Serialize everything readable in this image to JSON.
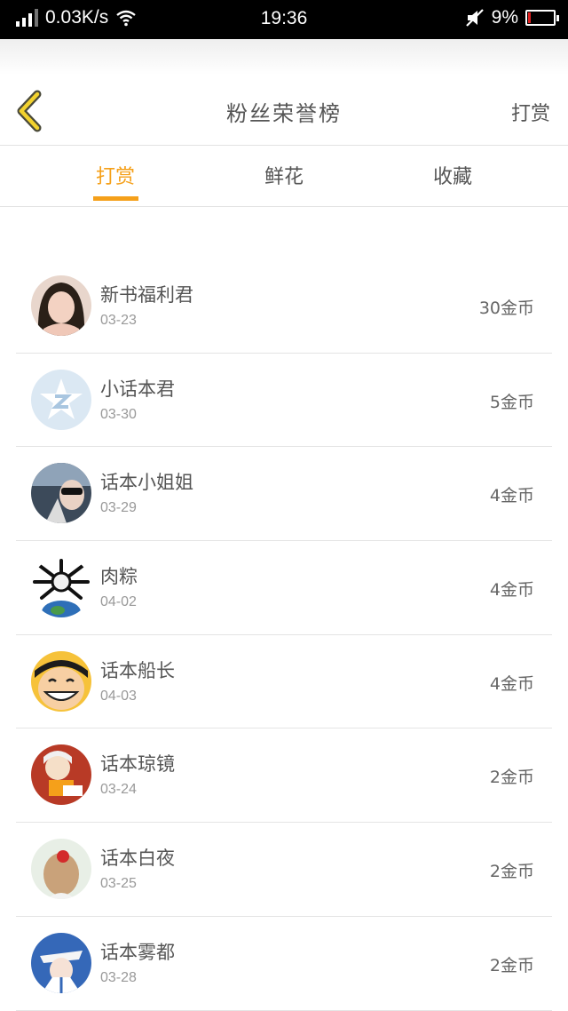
{
  "status": {
    "speed": "0.03K/s",
    "time": "19:36",
    "battery": "9%",
    "battery_level": 0.09
  },
  "nav": {
    "title": "粉丝荣誉榜",
    "right_label": "打赏"
  },
  "tabs": [
    {
      "label": "打赏",
      "active": true
    },
    {
      "label": "鲜花",
      "active": false
    },
    {
      "label": "收藏",
      "active": false
    }
  ],
  "colors": {
    "accent": "#f5a01a"
  },
  "fans": [
    {
      "name": "新书福利君",
      "date": "03-23",
      "amount": "30金币"
    },
    {
      "name": "小话本君",
      "date": "03-30",
      "amount": "5金币"
    },
    {
      "name": "话本小姐姐",
      "date": "03-29",
      "amount": "4金币"
    },
    {
      "name": "肉粽",
      "date": "04-02",
      "amount": "4金币"
    },
    {
      "name": "话本船长",
      "date": "04-03",
      "amount": "4金币"
    },
    {
      "name": "话本琼镜",
      "date": "03-24",
      "amount": "2金币"
    },
    {
      "name": "话本白夜",
      "date": "03-25",
      "amount": "2金币"
    },
    {
      "name": "话本雾都",
      "date": "03-28",
      "amount": "2金币"
    }
  ]
}
